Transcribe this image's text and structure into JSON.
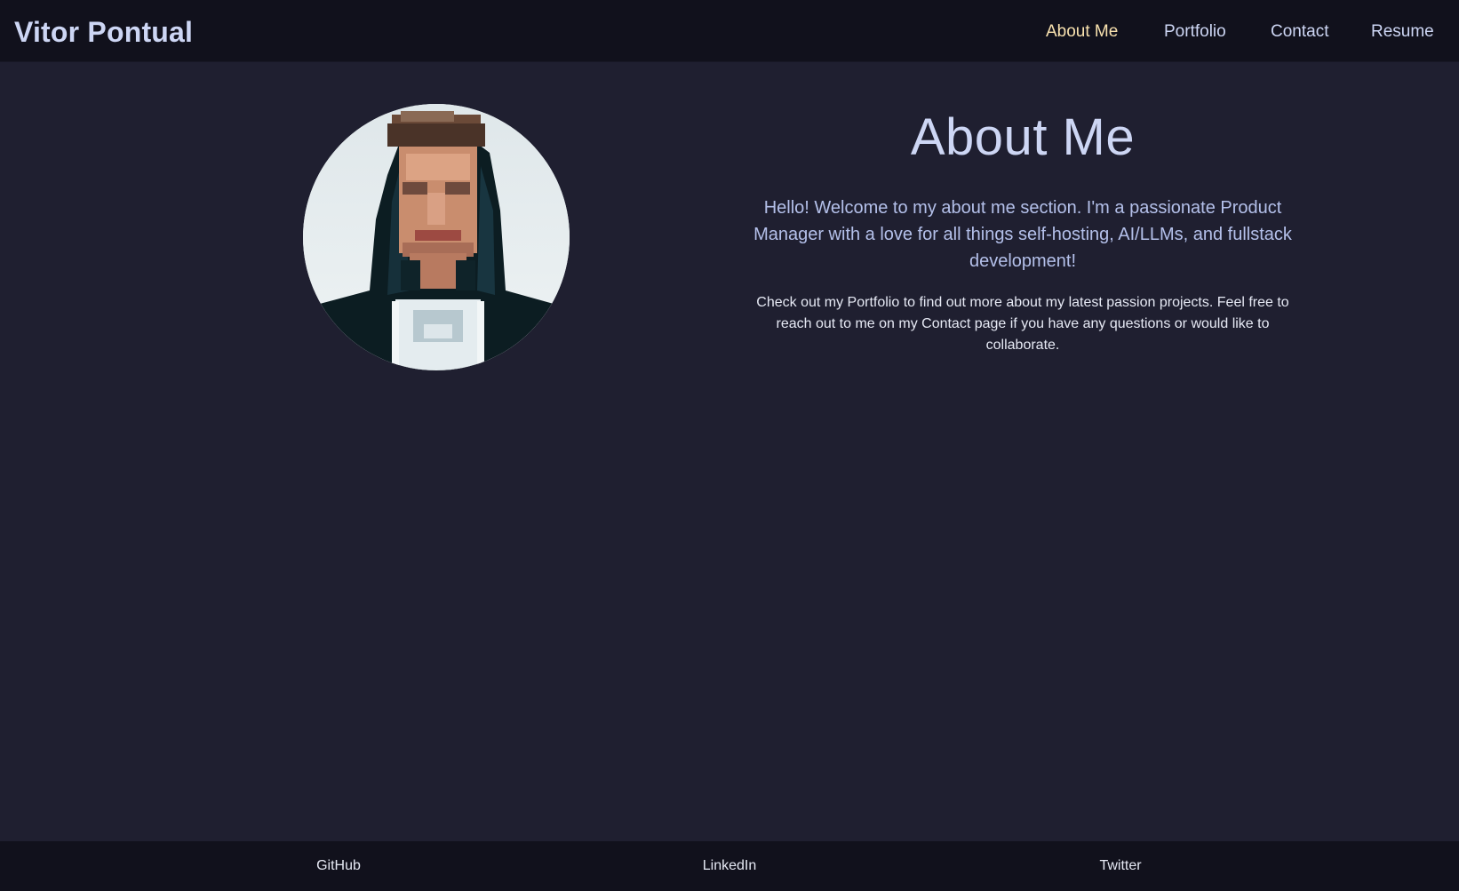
{
  "site": {
    "brand": "Vitor Pontual"
  },
  "nav": {
    "items": [
      {
        "label": "About Me",
        "active": true
      },
      {
        "label": "Portfolio",
        "active": false
      },
      {
        "label": "Contact",
        "active": false
      },
      {
        "label": "Resume",
        "active": false
      }
    ]
  },
  "about": {
    "title": "About Me",
    "lead": "Hello! Welcome to my about me section. I'm a passionate Product Manager with a love for all things self-hosting, AI/LLMs, and fullstack development!",
    "body": "Check out my Portfolio to find out more about my latest passion projects. Feel free to reach out to me on my Contact page if you have any questions or would like to collaborate."
  },
  "footer": {
    "links": [
      {
        "label": "GitHub"
      },
      {
        "label": "LinkedIn"
      },
      {
        "label": "Twitter"
      }
    ]
  },
  "colors": {
    "background": "#1f1f30",
    "bar": "#11111c",
    "text": "#cdd6f4",
    "active": "#f9e2af"
  }
}
